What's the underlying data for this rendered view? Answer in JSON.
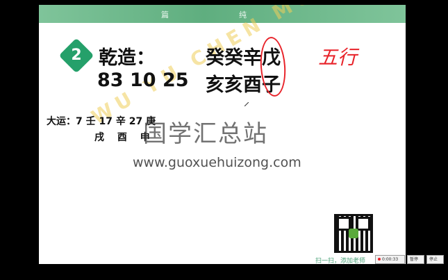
{
  "slide": {
    "header_left": "篇",
    "header_right": "纯",
    "badge_number": "2",
    "label": "乾造：",
    "date": "83 10 25",
    "stems": "癸癸辛戊",
    "branches": "亥亥酉子",
    "annotation": "五行",
    "dayun_line1": "大运：7 壬 17 辛 27 庚",
    "dayun_line2": "戌 酉 申"
  },
  "watermark": {
    "site_name": "国学汇总站",
    "url": "www.guoxuehuizong.com",
    "diagonal": "WU YU CHEN MU YAN"
  },
  "qr": {
    "caption": "扫一扫，添加老师"
  },
  "taskbar": {
    "recording_time": "0:00:33",
    "btn2": "暂停",
    "btn3": "停止"
  },
  "colors": {
    "badge": "#25a06a",
    "annotation_red": "#e8232a",
    "header_green": "#5fae7f"
  }
}
